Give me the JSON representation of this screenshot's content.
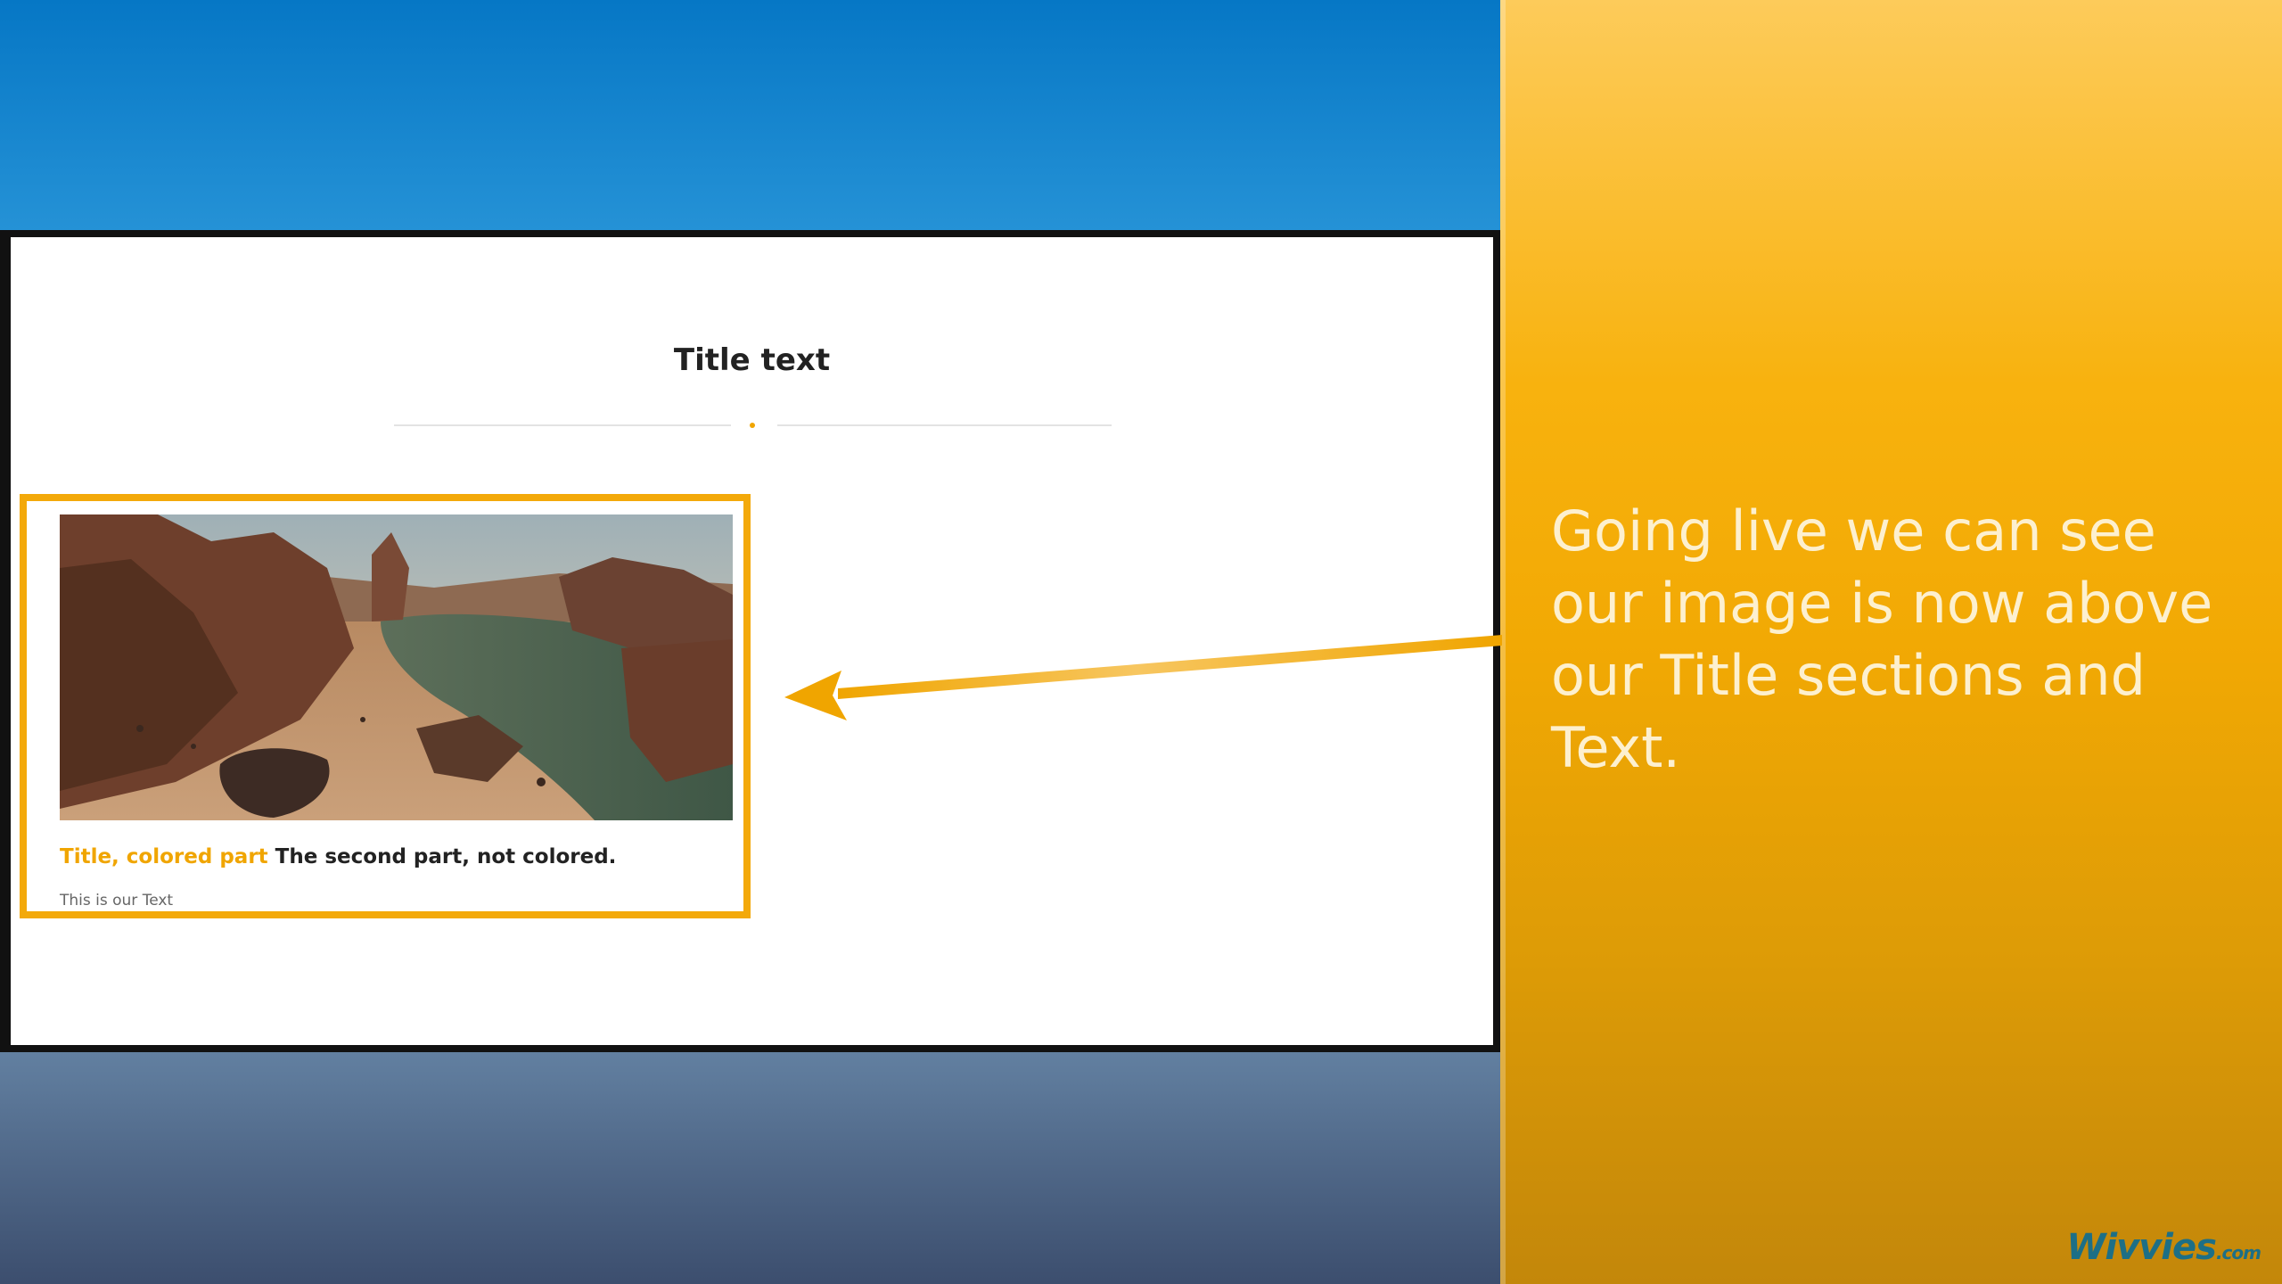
{
  "slide": {
    "annotation": "Going live we can see our image is now above our Title sections and Text.",
    "brand": {
      "name": "Wivvies",
      "suffix": ".com"
    }
  },
  "page": {
    "title": "Title text",
    "card": {
      "title_colored": "Title, colored part",
      "title_plain": "The second part, not colored.",
      "text": "This is our Text",
      "image_alt": "Desert canyon landscape with water"
    }
  },
  "colors": {
    "accent": "#f3a90a",
    "panel": "#f2a904",
    "brand": "#1d6f86"
  }
}
